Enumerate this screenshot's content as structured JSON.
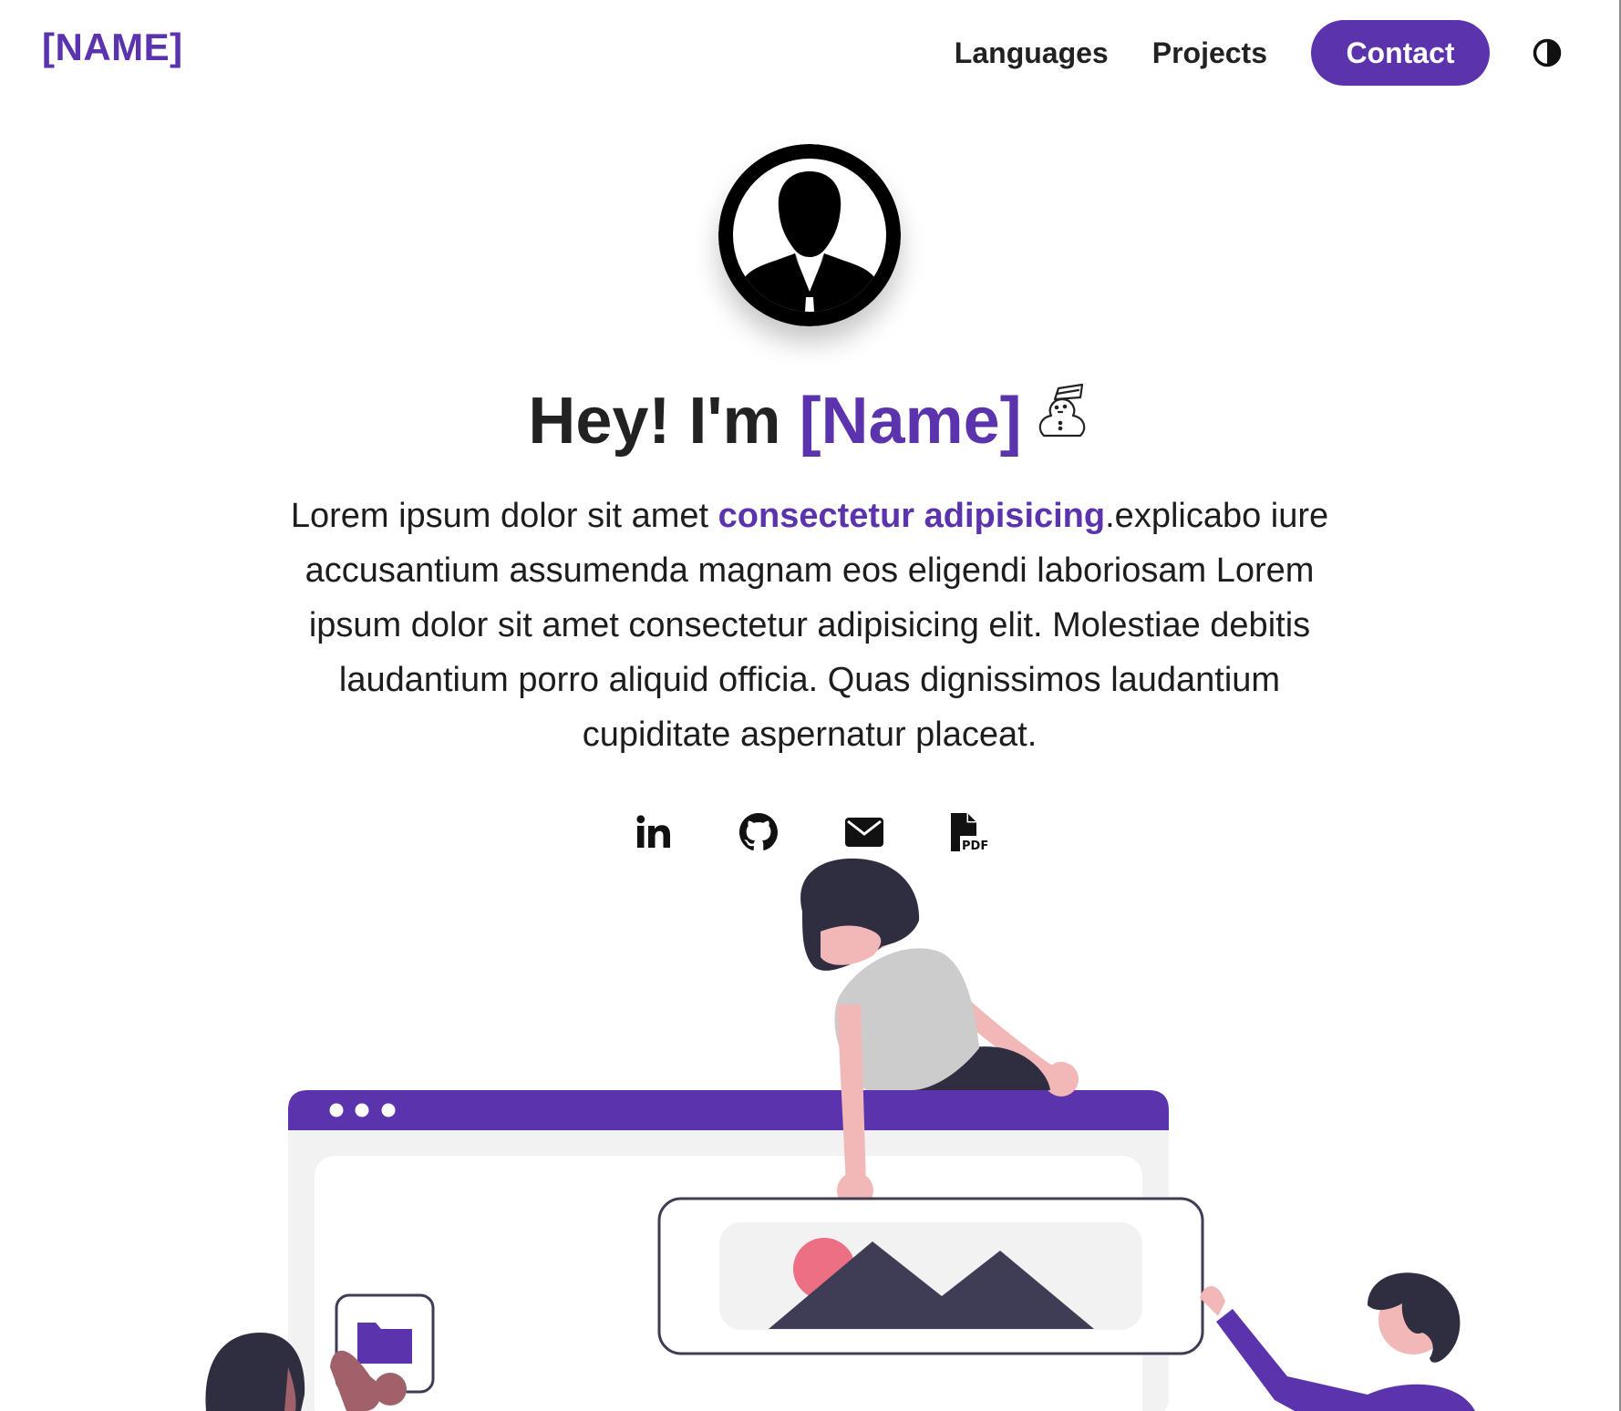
{
  "nav": {
    "brand": "[NAME]",
    "links": [
      "Languages",
      "Projects"
    ],
    "contact": "Contact"
  },
  "hero": {
    "greeting": "Hey! I'm",
    "name": "[Name]",
    "emoji": "snowman-icon"
  },
  "bio": {
    "before": "Lorem ipsum dolor sit amet ",
    "link": "consectetur adipisicing",
    "after": ".explicabo iure accusantium assumenda magnam eos eligendi laboriosam Lorem ipsum dolor sit amet consectetur adipisicing elit. Molestiae debitis laudantium porro aliquid officia. Quas dignissimos laudantium cupiditate aspernatur placeat."
  },
  "socials": [
    "linkedin-icon",
    "github-icon",
    "email-icon",
    "pdf-resume-icon"
  ],
  "colors": {
    "accent": "#5b33ad",
    "text": "#222222",
    "skin": "#f2b8b8",
    "dark": "#2f2e41",
    "gray": "#cccccc",
    "light_gray": "#f2f2f2",
    "sun": "#ec6f83"
  }
}
